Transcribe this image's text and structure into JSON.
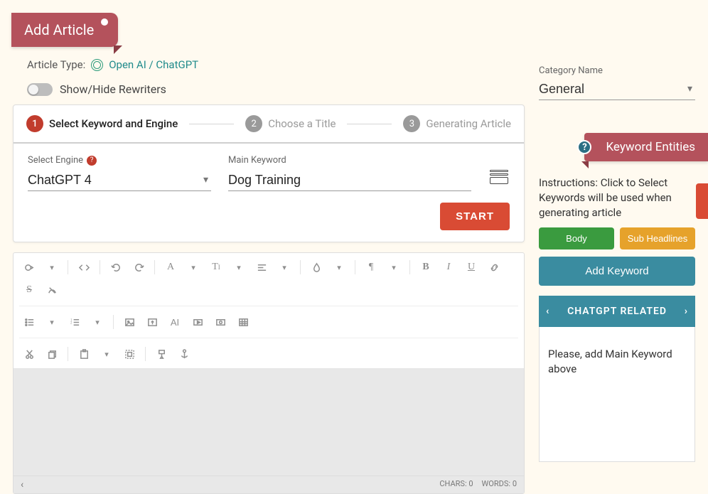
{
  "header": {
    "title": "Add Article"
  },
  "article_type": {
    "label": "Article Type:",
    "link": "Open AI / ChatGPT"
  },
  "toggle": {
    "label": "Show/Hide Rewriters"
  },
  "stepper": {
    "steps": [
      {
        "num": "1",
        "label": "Select Keyword and Engine"
      },
      {
        "num": "2",
        "label": "Choose a Title"
      },
      {
        "num": "3",
        "label": "Generating Article"
      }
    ]
  },
  "engine": {
    "label": "Select Engine",
    "value": "ChatGPT 4"
  },
  "keyword": {
    "label": "Main Keyword",
    "value": "Dog Training"
  },
  "start_button": "START",
  "editor_footer": {
    "chars_label": "CHARS:",
    "chars": "0",
    "words_label": "WORDS:",
    "words": "0"
  },
  "category": {
    "label": "Category Name",
    "value": "General"
  },
  "entities": {
    "ribbon": "Keyword Entities",
    "instructions": "Instructions: Click to Select Keywords will be used when generating article",
    "body_btn": "Body",
    "sub_btn": "Sub Headlines",
    "add_btn": "Add Keyword",
    "related_header": "CHATGPT RELATED",
    "related_placeholder": "Please, add Main Keyword above"
  }
}
